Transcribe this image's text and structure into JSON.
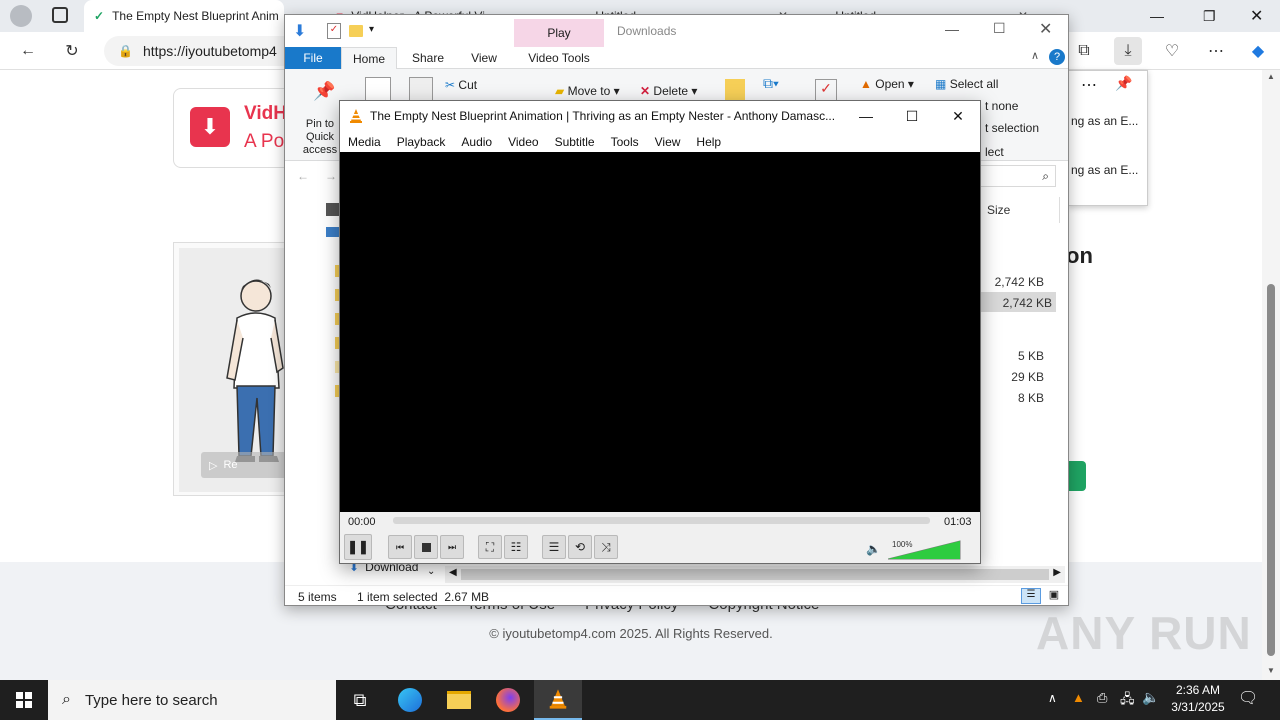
{
  "browser": {
    "tabs": [
      {
        "title": "The Empty Nest Blueprint Anim"
      },
      {
        "title": "VidHelper - A Powerful Video Do"
      },
      {
        "title": "Untitled"
      },
      {
        "title": "Untitled"
      }
    ],
    "url": "https://iyoutubetomp4"
  },
  "website": {
    "brand_name": "VidH",
    "brand_tagline": "A Po",
    "heading_fragment": "on",
    "thumb_button": "Re",
    "footer_links": [
      "Contact",
      "Terms of Use",
      "Privacy Policy",
      "Copyright Notice"
    ],
    "copyright": "© iyoutubetomp4.com 2025. All Rights Reserved."
  },
  "downloads_panel": {
    "items": [
      "ng as an E...",
      "ng as an E..."
    ]
  },
  "explorer": {
    "title": "Downloads",
    "context_tab": "Play",
    "tabs": [
      "File",
      "Home",
      "Share",
      "View",
      "Video Tools"
    ],
    "ribbon": {
      "pin": "Pin to Quick access",
      "cut": "Cut",
      "move_to": "Move to",
      "delete": "Delete",
      "open": "Open",
      "select_all": "Select all",
      "select_none": "t none",
      "invert": "t selection",
      "select_group": "lect"
    },
    "column_size": "Size",
    "sizes": [
      "2,742 KB",
      "2,742 KB",
      "5 KB",
      "29 KB",
      "8 KB"
    ],
    "nav_item": "Download",
    "status_items": "5 items",
    "status_selected": "1 item selected  2.67 MB"
  },
  "vlc": {
    "title": "The Empty Nest Blueprint Animation  |  Thriving as an Empty Nester - Anthony Damasc...",
    "menu": [
      "Media",
      "Playback",
      "Audio",
      "Video",
      "Subtitle",
      "Tools",
      "View",
      "Help"
    ],
    "time_elapsed": "00:00",
    "time_total": "01:03",
    "progress": 0,
    "volume_label": "100%",
    "volume": 1.0
  },
  "taskbar": {
    "search_placeholder": "Type here to search",
    "time": "2:36 AM",
    "date": "3/31/2025"
  },
  "watermark": "ANY RUN"
}
